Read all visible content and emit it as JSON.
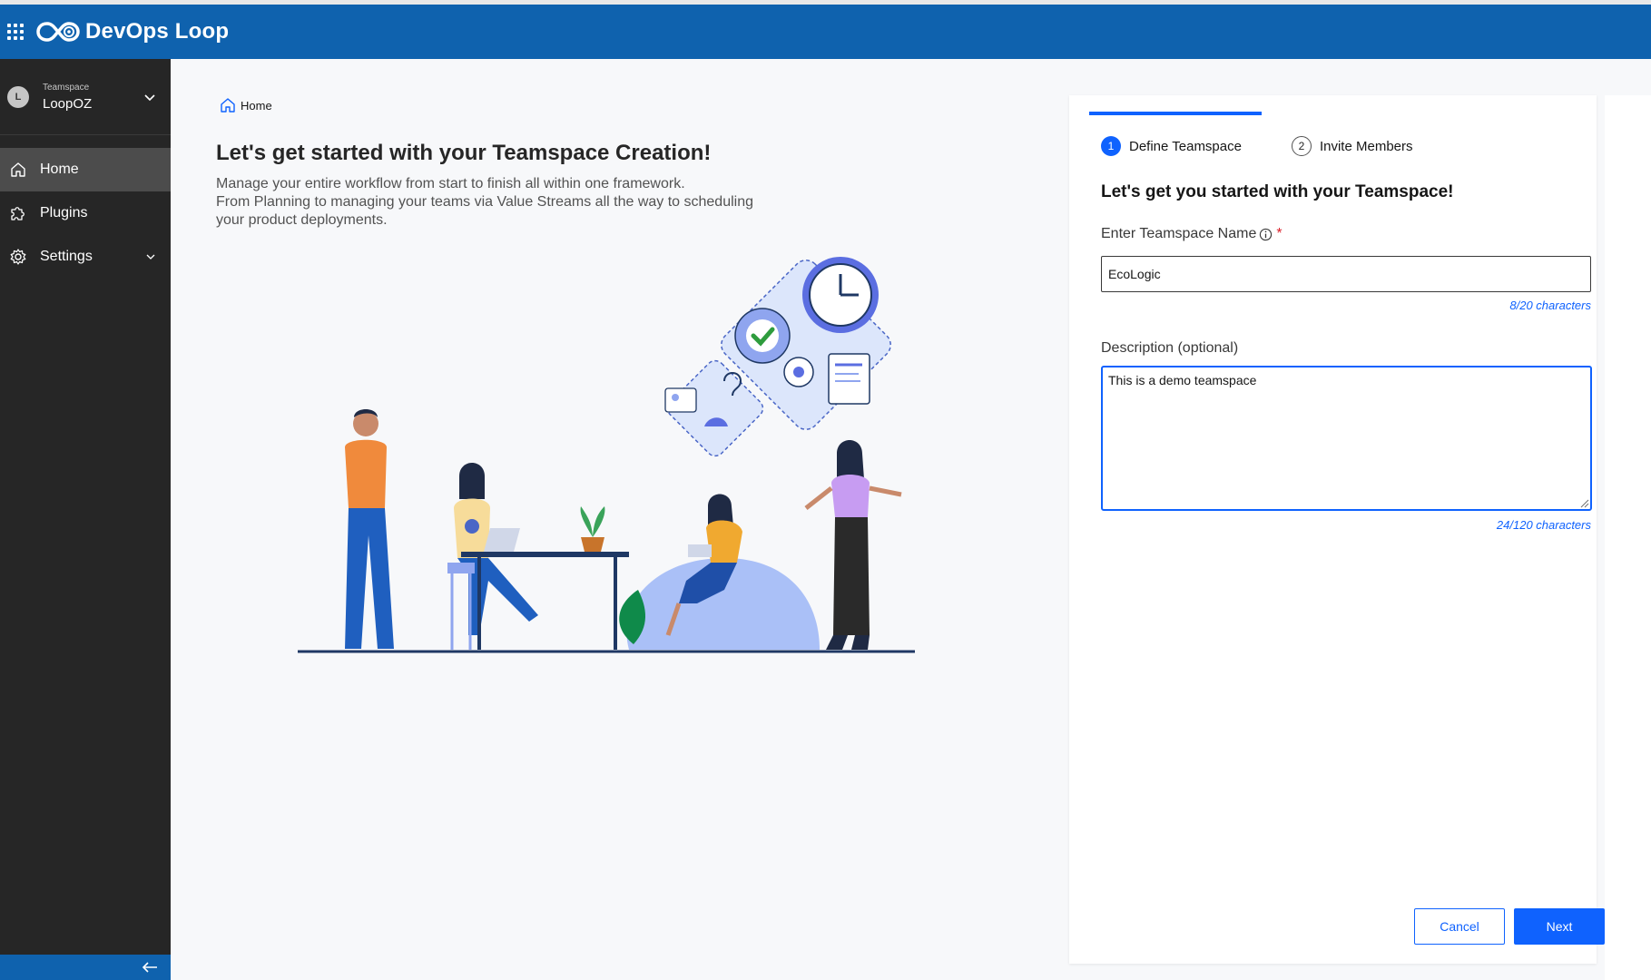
{
  "app": {
    "title": "DevOps Loop",
    "logo_icon": "infinity-loop-logo",
    "brand_color": "#0f62ae",
    "accent_color": "#0f62fe"
  },
  "sidebar": {
    "teamspace_label": "Teamspace",
    "teamspace_name": "LoopOZ",
    "teamspace_initial": "L",
    "items": [
      {
        "label": "Home",
        "icon": "home-icon",
        "active": true
      },
      {
        "label": "Plugins",
        "icon": "puzzle-icon",
        "active": false
      },
      {
        "label": "Settings",
        "icon": "gear-icon",
        "active": false,
        "has_submenu": true
      }
    ],
    "collapse_icon": "arrow-left-icon"
  },
  "main": {
    "breadcrumb": "Home",
    "title": "Let's get started with your Teamspace Creation!",
    "intro_lines": [
      "Manage your entire workflow from start to finish all within one framework.",
      "From Planning to managing your teams via Value Streams all the way to scheduling",
      "your product deployments."
    ]
  },
  "wizard": {
    "steps": [
      {
        "number": "1",
        "label": "Define Teamspace",
        "current": true
      },
      {
        "number": "2",
        "label": "Invite Members",
        "current": false
      }
    ],
    "title": "Let's get you started with your Teamspace!",
    "name_label": "Enter Teamspace Name",
    "required_mark": "*",
    "name_value": "EcoLogic",
    "name_counter": "8/20 characters",
    "desc_label": "Description (optional)",
    "desc_value": "This is a demo teamspace",
    "desc_counter": "24/120 characters",
    "cancel_label": "Cancel",
    "next_label": "Next"
  }
}
